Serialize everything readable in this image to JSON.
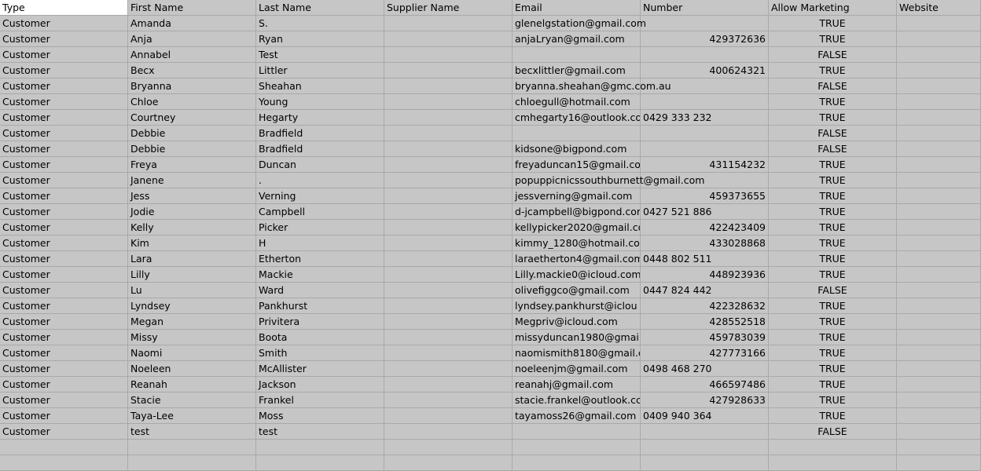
{
  "headers": [
    "Type",
    "First Name",
    "Last Name",
    "Supplier Name",
    "Email",
    "Number",
    "Allow Marketing",
    "Website"
  ],
  "rows": [
    {
      "type": "Customer",
      "first": "Amanda",
      "last": "S.",
      "supplier": "",
      "email": "glenelgstation@gmail.com",
      "number": "",
      "marketing": "TRUE",
      "website": ""
    },
    {
      "type": "Customer",
      "first": "Anja",
      "last": "Ryan",
      "supplier": "",
      "email": "anjaLryan@gmail.com",
      "number": "429372636",
      "marketing": "TRUE",
      "website": ""
    },
    {
      "type": "Customer",
      "first": "Annabel",
      "last": "Test",
      "supplier": "",
      "email": "",
      "number": "",
      "marketing": "FALSE",
      "website": ""
    },
    {
      "type": "Customer",
      "first": "Becx",
      "last": "Littler",
      "supplier": "",
      "email": "becxlittler@gmail.com",
      "number": "400624321",
      "marketing": "TRUE",
      "website": ""
    },
    {
      "type": "Customer",
      "first": "Bryanna",
      "last": "Sheahan",
      "supplier": "",
      "email": "bryanna.sheahan@gmc.com.au",
      "number": "",
      "marketing": "FALSE",
      "website": ""
    },
    {
      "type": "Customer",
      "first": "Chloe",
      "last": "Young",
      "supplier": "",
      "email": "chloegull@hotmail.com",
      "number": "",
      "marketing": "TRUE",
      "website": ""
    },
    {
      "type": "Customer",
      "first": "Courtney",
      "last": "Hegarty",
      "supplier": "",
      "email": "cmhegarty16@outlook.co",
      "number": "0429 333 232",
      "marketing": "TRUE",
      "website": ""
    },
    {
      "type": "Customer",
      "first": "Debbie",
      "last": "Bradfield",
      "supplier": "",
      "email": "",
      "number": "",
      "marketing": "FALSE",
      "website": ""
    },
    {
      "type": "Customer",
      "first": "Debbie",
      "last": "Bradfield",
      "supplier": "",
      "email": "kidsone@bigpond.com",
      "number": "",
      "marketing": "FALSE",
      "website": ""
    },
    {
      "type": "Customer",
      "first": "Freya",
      "last": "Duncan",
      "supplier": "",
      "email": "freyaduncan15@gmail.cor",
      "number": "431154232",
      "marketing": "TRUE",
      "website": ""
    },
    {
      "type": "Customer",
      "first": "Janene",
      "last": ".",
      "supplier": "",
      "email": "popuppicnicssouthburnett@gmail.com",
      "number": "",
      "marketing": "TRUE",
      "website": ""
    },
    {
      "type": "Customer",
      "first": "Jess",
      "last": "Verning",
      "supplier": "",
      "email": "jessverning@gmail.com",
      "number": "459373655",
      "marketing": "TRUE",
      "website": ""
    },
    {
      "type": "Customer",
      "first": "Jodie",
      "last": "Campbell",
      "supplier": "",
      "email": "d-jcampbell@bigpond.cor",
      "number": "0427 521 886",
      "marketing": "TRUE",
      "website": ""
    },
    {
      "type": "Customer",
      "first": "Kelly",
      "last": "Picker",
      "supplier": "",
      "email": "kellypicker2020@gmail.co",
      "number": "422423409",
      "marketing": "TRUE",
      "website": ""
    },
    {
      "type": "Customer",
      "first": "Kim",
      "last": "H",
      "supplier": "",
      "email": "kimmy_1280@hotmail.cor",
      "number": "433028868",
      "marketing": "TRUE",
      "website": ""
    },
    {
      "type": "Customer",
      "first": "Lara",
      "last": "Etherton",
      "supplier": "",
      "email": "laraetherton4@gmail.com",
      "number": "0448 802 511",
      "marketing": "TRUE",
      "website": ""
    },
    {
      "type": "Customer",
      "first": "Lilly",
      "last": "Mackie",
      "supplier": "",
      "email": "Lilly.mackie0@icloud.com",
      "number": "448923936",
      "marketing": "TRUE",
      "website": ""
    },
    {
      "type": "Customer",
      "first": "Lu",
      "last": "Ward",
      "supplier": "",
      "email": "olivefiggco@gmail.com",
      "number": "0447 824 442",
      "marketing": "FALSE",
      "website": ""
    },
    {
      "type": "Customer",
      "first": "Lyndsey",
      "last": "Pankhurst",
      "supplier": "",
      "email": "lyndsey.pankhurst@iclou",
      "number": "422328632",
      "marketing": "TRUE",
      "website": ""
    },
    {
      "type": "Customer",
      "first": "Megan",
      "last": "Privitera",
      "supplier": "",
      "email": "Megpriv@icloud.com",
      "number": "428552518",
      "marketing": "TRUE",
      "website": ""
    },
    {
      "type": "Customer",
      "first": "Missy",
      "last": "Boota",
      "supplier": "",
      "email": "missyduncan1980@gmail.",
      "number": "459783039",
      "marketing": "TRUE",
      "website": ""
    },
    {
      "type": "Customer",
      "first": "Naomi",
      "last": "Smith",
      "supplier": "",
      "email": "naomismith8180@gmail.c",
      "number": "427773166",
      "marketing": "TRUE",
      "website": ""
    },
    {
      "type": "Customer",
      "first": "Noeleen",
      "last": "McAllister",
      "supplier": "",
      "email": "noeleenjm@gmail.com",
      "number": "0498 468 270",
      "marketing": "TRUE",
      "website": ""
    },
    {
      "type": "Customer",
      "first": "Reanah",
      "last": "Jackson",
      "supplier": "",
      "email": "reanahj@gmail.com",
      "number": "466597486",
      "marketing": "TRUE",
      "website": ""
    },
    {
      "type": "Customer",
      "first": "Stacie",
      "last": "Frankel",
      "supplier": "",
      "email": "stacie.frankel@outlook.cc",
      "number": "427928633",
      "marketing": "TRUE",
      "website": ""
    },
    {
      "type": "Customer",
      "first": "Taya-Lee",
      "last": "Moss",
      "supplier": "",
      "email": "tayamoss26@gmail.com",
      "number": "0409 940 364",
      "marketing": "TRUE",
      "website": ""
    },
    {
      "type": "Customer",
      "first": "test",
      "last": "test",
      "supplier": "",
      "email": "",
      "number": "",
      "marketing": "FALSE",
      "website": ""
    }
  ],
  "colors": {
    "background": "#c6c6c6",
    "gridline": "#a9a9a9",
    "selected_cell": "#ffffff"
  }
}
